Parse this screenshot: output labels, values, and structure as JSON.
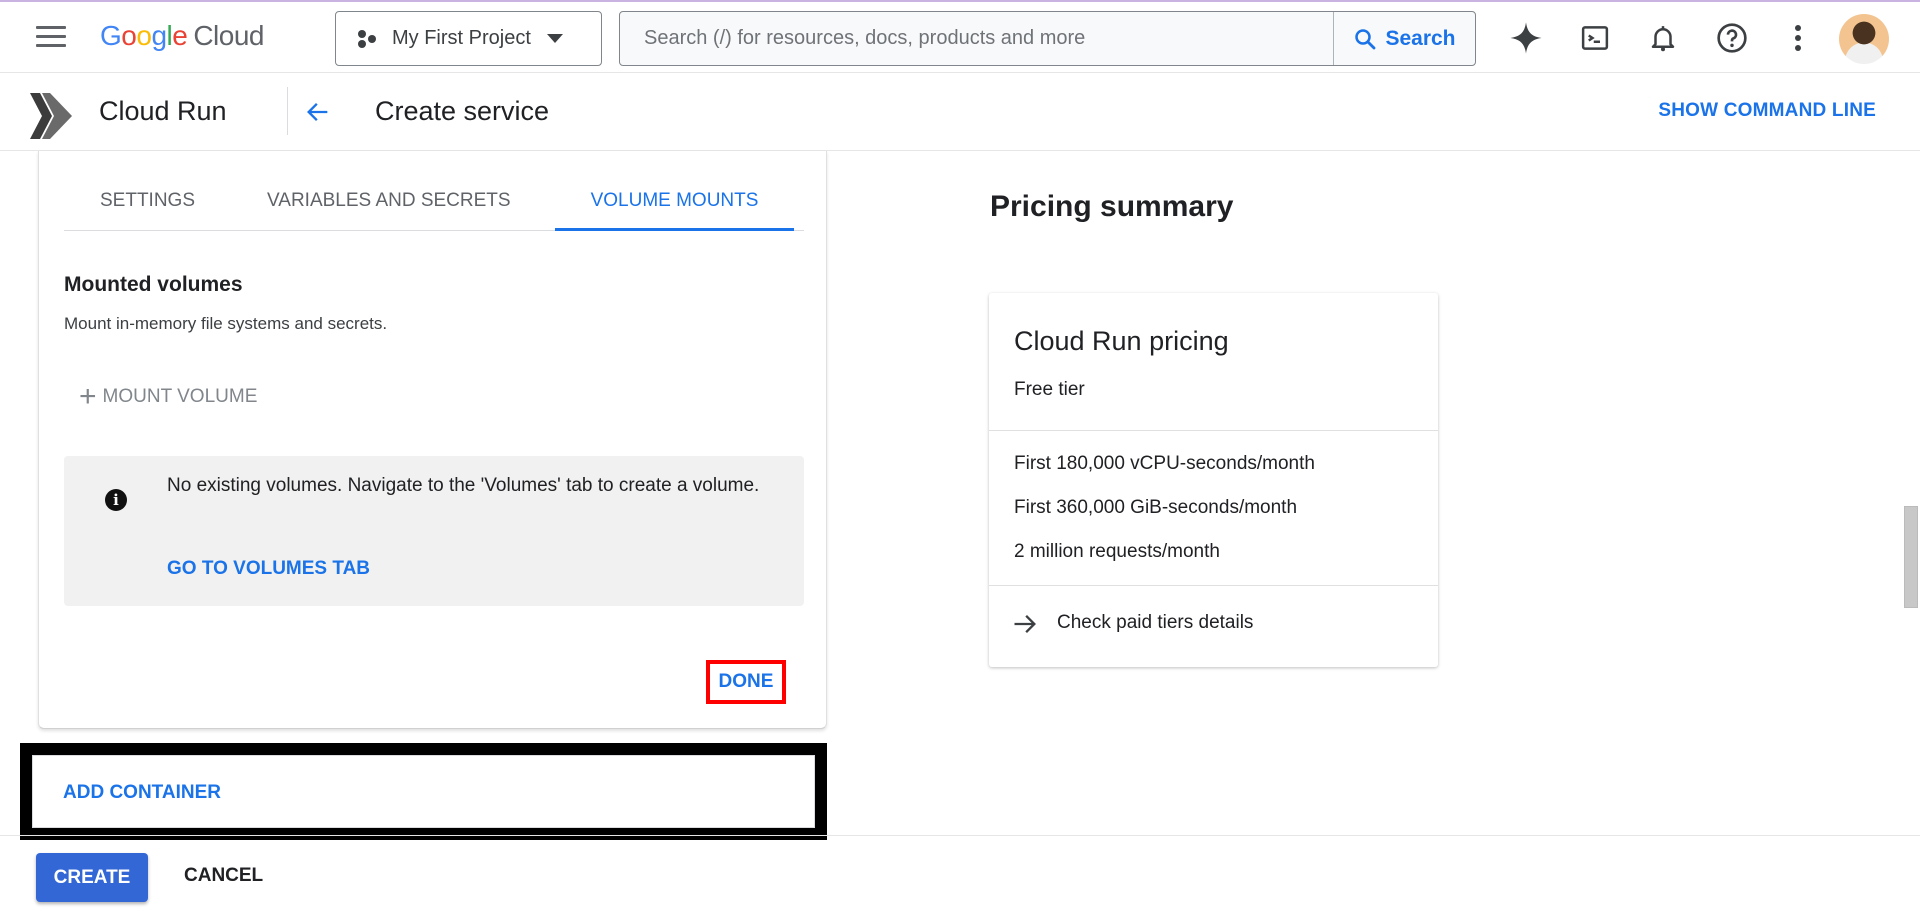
{
  "topbar": {
    "logo": {
      "google": "Google",
      "cloud": "Cloud"
    },
    "project": "My First Project",
    "search": {
      "placeholder": "Search (/) for resources, docs, products and more",
      "button_label": "Search"
    },
    "icons": [
      "gemini-icon",
      "cloud-shell-icon",
      "notifications-icon",
      "help-icon",
      "more-vert-icon",
      "avatar"
    ]
  },
  "subbar": {
    "product": "Cloud Run",
    "page_title": "Create service",
    "show_command_line": "SHOW COMMAND LINE"
  },
  "container_panel": {
    "tabs": [
      {
        "label": "SETTINGS",
        "active": false
      },
      {
        "label": "VARIABLES AND SECRETS",
        "active": false
      },
      {
        "label": "VOLUME MOUNTS",
        "active": true
      }
    ],
    "section_title": "Mounted volumes",
    "section_desc": "Mount in-memory file systems and secrets.",
    "mount_volume_label": "MOUNT VOLUME",
    "info": {
      "text": "No existing volumes. Navigate to the 'Volumes' tab to create a volume.",
      "link": "GO TO VOLUMES TAB"
    },
    "done_label": "DONE"
  },
  "add_container_label": "ADD CONTAINER",
  "footer": {
    "create_label": "CREATE",
    "cancel_label": "CANCEL"
  },
  "pricing": {
    "title": "Pricing summary",
    "card": {
      "title": "Cloud Run pricing",
      "subtitle": "Free tier",
      "items": [
        "First 180,000 vCPU-seconds/month",
        "First 360,000 GiB-seconds/month",
        "2 million requests/month"
      ],
      "link": "Check paid tiers details"
    }
  },
  "colors": {
    "accent": "#1a73e8",
    "primary_button": "#3367d6",
    "highlight_red": "#ff0000",
    "highlight_black": "#000000"
  }
}
